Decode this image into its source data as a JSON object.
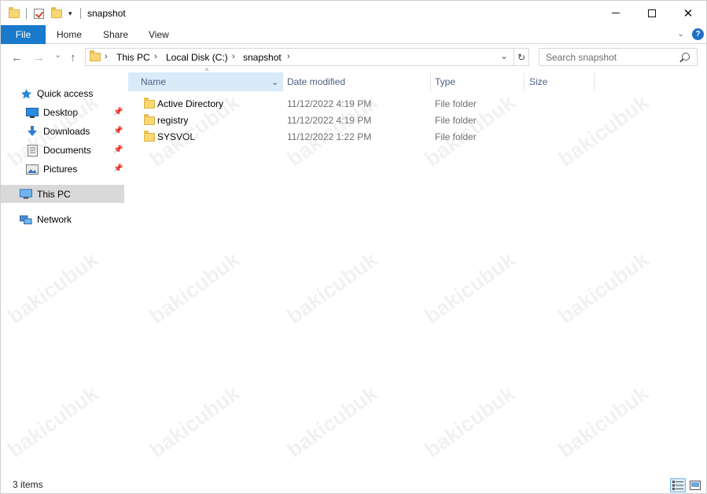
{
  "titlebar": {
    "title": "snapshot",
    "qa_dropdown": "▾",
    "minimize_icon": "minimize-icon",
    "maximize_icon": "maximize-icon",
    "close_glyph": "✕"
  },
  "ribbon": {
    "tabs": [
      "File",
      "Home",
      "Share",
      "View"
    ],
    "expand_glyph": "⌄",
    "help_glyph": "?"
  },
  "nav": {
    "back_glyph": "←",
    "forward_glyph": "→",
    "recent_glyph": "⌄",
    "up_glyph": "↑",
    "breadcrumb": [
      "This PC",
      "Local Disk (C:)",
      "snapshot"
    ],
    "crumb_separator": "›",
    "dropdown_glyph": "⌄",
    "refresh_glyph": "↻",
    "search_placeholder": "Search snapshot"
  },
  "sidebar": {
    "quick_access": "Quick access",
    "pinned": [
      {
        "label": "Desktop",
        "icon": "desktop-icon"
      },
      {
        "label": "Downloads",
        "icon": "downloads-icon"
      },
      {
        "label": "Documents",
        "icon": "documents-icon"
      },
      {
        "label": "Pictures",
        "icon": "pictures-icon"
      }
    ],
    "this_pc": "This PC",
    "network": "Network",
    "pin_glyph": "📌"
  },
  "columns": {
    "name": "Name",
    "date": "Date modified",
    "type": "Type",
    "size": "Size",
    "sort_glyph": "^",
    "name_dropdown": "⌄"
  },
  "files": [
    {
      "name": "Active Directory",
      "date": "11/12/2022 4:19 PM",
      "type": "File folder"
    },
    {
      "name": "registry",
      "date": "11/12/2022 4:19 PM",
      "type": "File folder"
    },
    {
      "name": "SYSVOL",
      "date": "11/12/2022 1:22 PM",
      "type": "File folder"
    }
  ],
  "status": {
    "item_count": "3 items"
  },
  "watermark": "bakicubuk",
  "colors": {
    "accent": "#1979ca",
    "folder": "#f7d774",
    "selected_nav": "#d9d9d9",
    "header_highlight": "#d9ebf9"
  }
}
